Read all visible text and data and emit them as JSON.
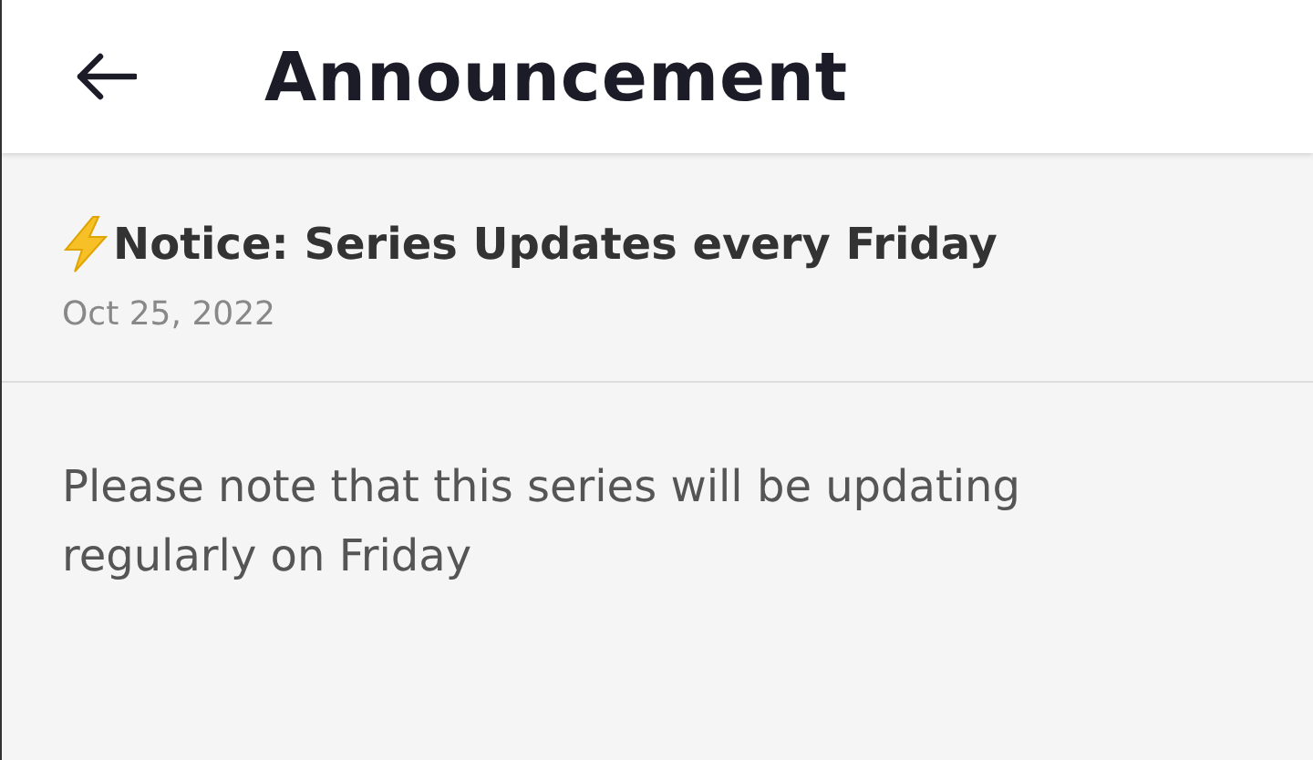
{
  "header": {
    "title": "Announcement"
  },
  "notice": {
    "title": "Notice: Series Updates every Friday",
    "date": "Oct 25, 2022",
    "body": "Please note that this series will be updating regularly on Friday"
  }
}
